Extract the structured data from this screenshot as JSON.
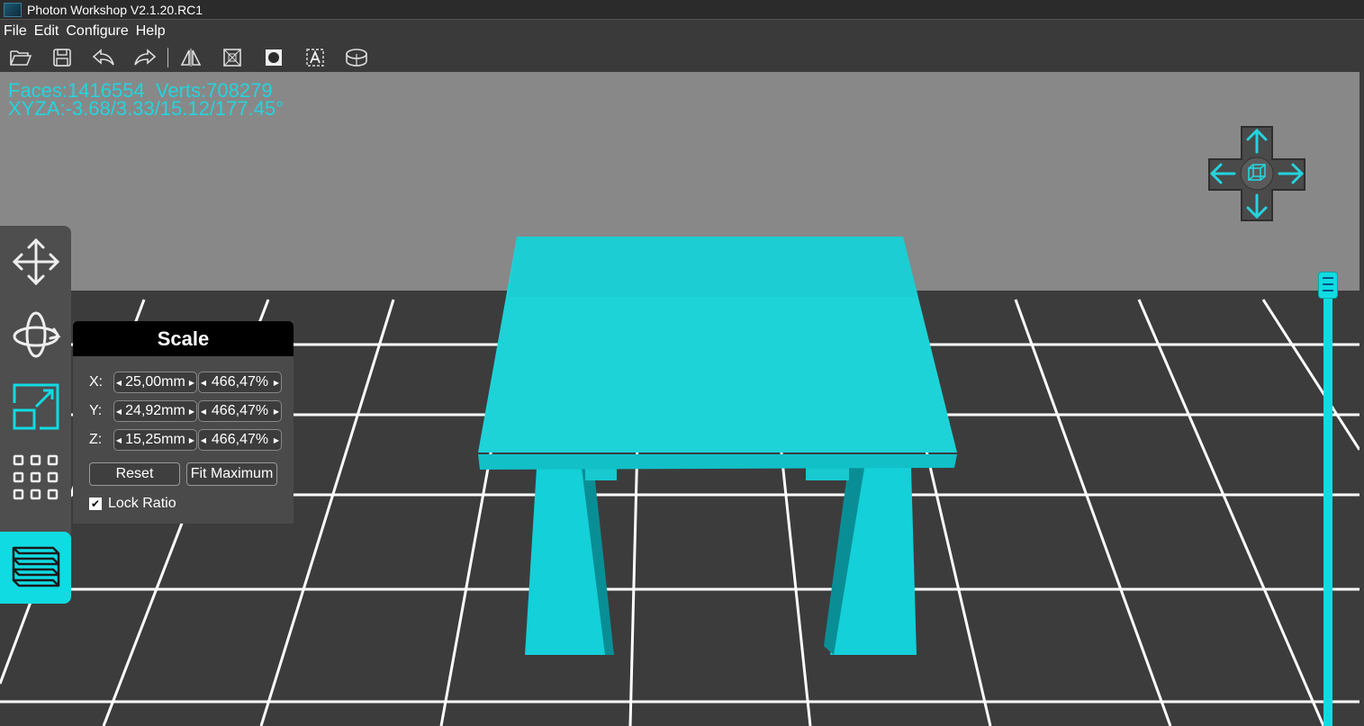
{
  "window": {
    "title": "Photon Workshop V2.1.20.RC1",
    "app_icon": "photon-logo-icon"
  },
  "menu": [
    "File",
    "Edit",
    "Configure",
    "Help"
  ],
  "toolbar": {
    "items": [
      {
        "name": "open-folder-icon"
      },
      {
        "name": "save-icon"
      },
      {
        "name": "undo-icon"
      },
      {
        "name": "redo-icon"
      },
      {
        "name": "mirror-icon"
      },
      {
        "name": "hollow-icon"
      },
      {
        "name": "punch-hole-icon"
      },
      {
        "name": "text-icon"
      },
      {
        "name": "base-icon"
      }
    ]
  },
  "info": {
    "faces_line": "Faces:1416554  Verts:708279",
    "xyza_line": "XYZA:-3.68/3.33/15.12/177.45°"
  },
  "left_tools": [
    "move-tool",
    "rotate-tool",
    "scale-tool",
    "array-tool",
    "layers-tool"
  ],
  "scale_panel": {
    "title": "Scale",
    "rows": [
      {
        "label": "X:",
        "mm": "25,00mm",
        "pct": "466,47%"
      },
      {
        "label": "Y:",
        "mm": "24,92mm",
        "pct": "466,47%"
      },
      {
        "label": "Z:",
        "mm": "15,25mm",
        "pct": "466,47%"
      }
    ],
    "reset": "Reset",
    "fit_maximum": "Fit Maximum",
    "lock_ratio": "Lock Ratio",
    "lock_checked": true
  },
  "colors": {
    "accent": "#11dbe2",
    "model": "#1ed3d8",
    "grid_line": "#ffffff",
    "floor": "#3c3c3c",
    "sky": "#888888"
  }
}
